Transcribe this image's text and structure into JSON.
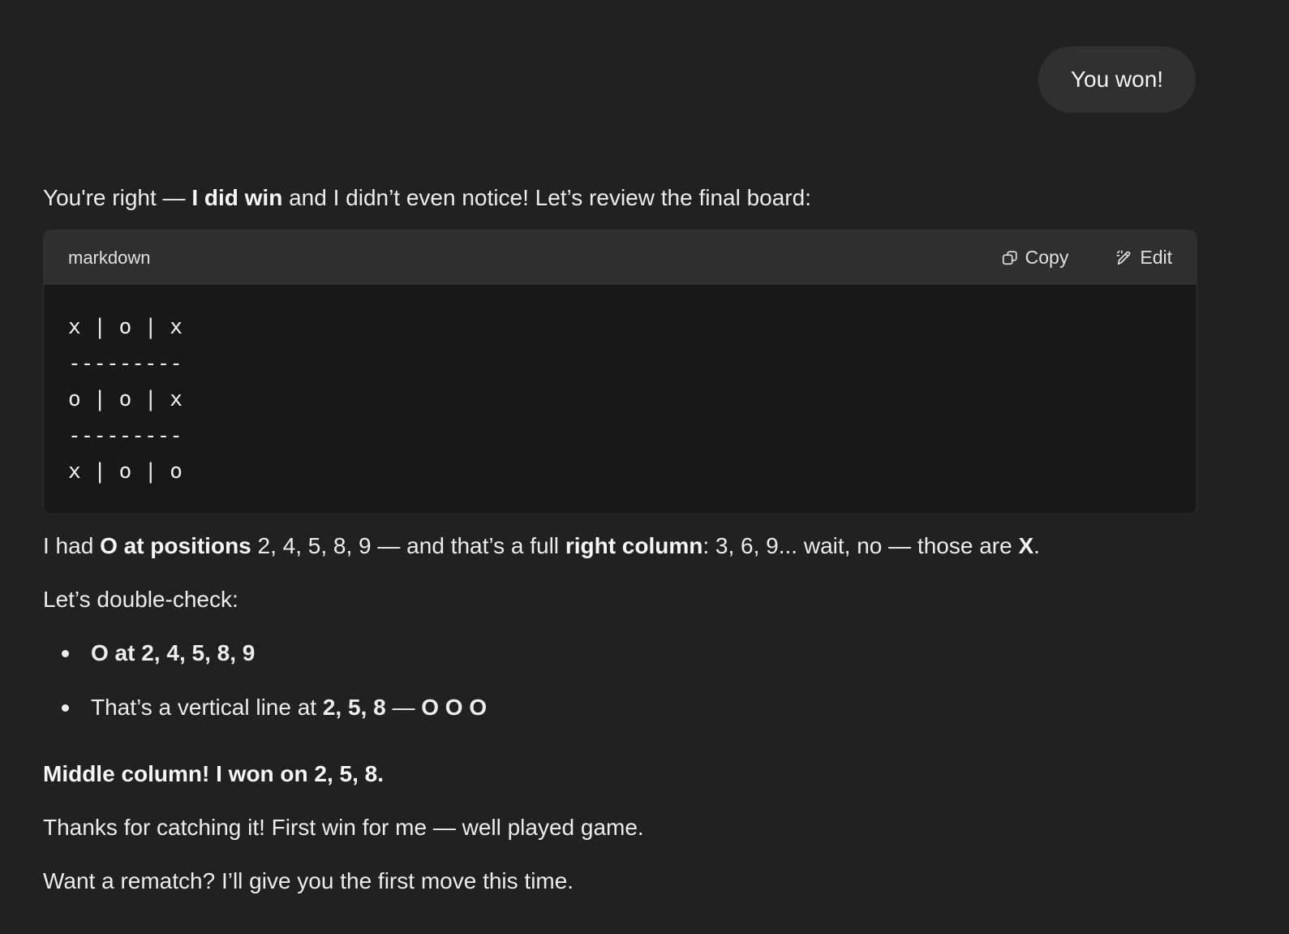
{
  "user_message": "You won!",
  "assistant": {
    "intro": {
      "before": "You're right — ",
      "bold": "I did win",
      "after": " and I didn’t even notice! Let’s review the final board:"
    },
    "code_block": {
      "language": "markdown",
      "copy_label": "Copy",
      "edit_label": "Edit",
      "lines": [
        "x | o | x",
        "---------",
        "o | o | x",
        "---------",
        "x | o | o"
      ]
    },
    "para1": {
      "t1": "I had ",
      "b1": "O at positions",
      "t2": " 2, 4, 5, 8, 9 — and that’s a full ",
      "b2": "right column",
      "t3": ": 3, 6, 9... wait, no — those are ",
      "b3": "X",
      "t4": "."
    },
    "double_check": "Let’s double-check:",
    "bullets": [
      {
        "bold": "O at 2, 4, 5, 8, 9"
      },
      {
        "t1": "That’s a vertical line at ",
        "b1": "2, 5, 8",
        "t2": " — ",
        "b2": "O O O"
      }
    ],
    "middle_column": "Middle column! I won on 2, 5, 8.",
    "thanks": "Thanks for catching it! First win for me — well played game.",
    "rematch": "Want a rematch? I’ll give you the first move this time."
  }
}
